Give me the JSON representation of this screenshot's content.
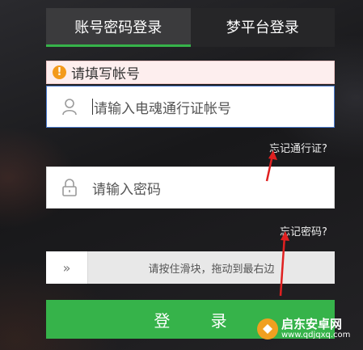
{
  "tabs": [
    {
      "label": "账号密码登录",
      "active": true
    },
    {
      "label": "梦平台登录",
      "active": false
    }
  ],
  "error": {
    "icon": "warning-icon",
    "message": "请填写帐号"
  },
  "account_field": {
    "icon": "user-icon",
    "placeholder": "请输入电魂通行证帐号"
  },
  "forgot_account": "忘记通行证?",
  "password_field": {
    "icon": "lock-icon",
    "placeholder": "请输入密码"
  },
  "forgot_password": "忘记密码?",
  "slider": {
    "icon": "double-chevron-right-icon",
    "hint": "请按住滑块，拖动到最右边"
  },
  "login_button": "登 录",
  "watermark": {
    "title": "启东安卓网",
    "url": "www.qdjqxq.com"
  },
  "colors": {
    "accent": "#36b34a",
    "warning": "#f39a1c",
    "annotation_arrow": "#e02020",
    "error_bg": "#fdeeee"
  }
}
